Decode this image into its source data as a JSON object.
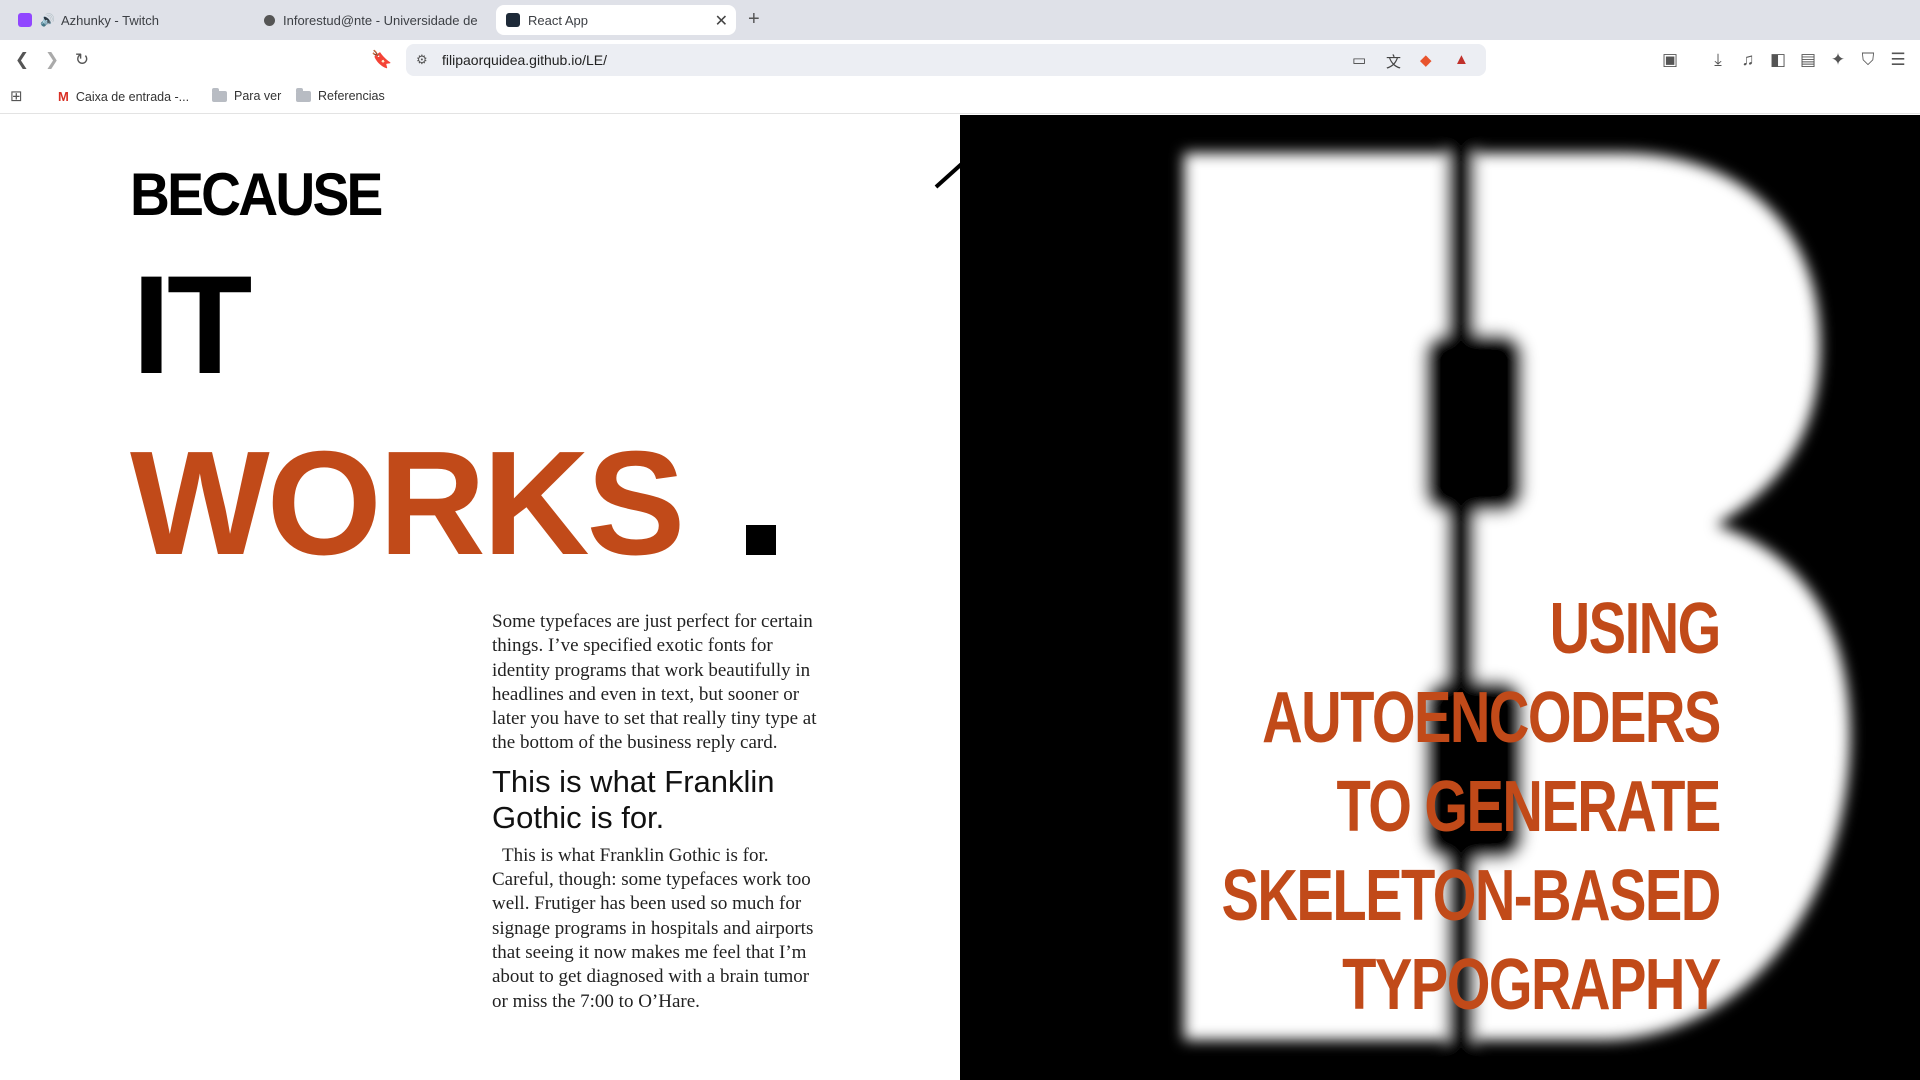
{
  "browser": {
    "tabs": [
      {
        "label": "Azhunky - Twitch",
        "favicon": "twitch-icon",
        "audio": true,
        "active": false
      },
      {
        "label": "Inforestud@nte - Universidade de",
        "favicon": "globe-icon",
        "active": false
      },
      {
        "label": "React App",
        "favicon": "react-icon",
        "active": true
      }
    ],
    "url": "filipaorquidea.github.io/LE/",
    "bookmarks": [
      {
        "label": "Caixa de entrada -...",
        "icon": "gmail-icon"
      },
      {
        "label": "Para ver",
        "icon": "folder-icon"
      },
      {
        "label": "Referencias",
        "icon": "folder-icon"
      }
    ]
  },
  "page": {
    "headline": {
      "line1": "BECAUSE",
      "line2": "IT",
      "line3": "WORKS",
      "accent_color": "#c14a19"
    },
    "paragraph1": "Some typefaces are just perfect for certain things. I’ve specified exotic fonts for identity programs that work beautifully in headlines and even in text, but sooner or later you have to set that really tiny type at the bottom of the business reply card.",
    "subheading": "This is what Franklin Gothic is for.",
    "paragraph2": "This is what Franklin Gothic is for. Careful, though: some typefaces work too well. Frutiger has been used so much for signage programs in hospitals and airports that seeing it now makes me feel that I’m about to get diagnosed with a brain tumor or miss the 7:00 to O’Hare.",
    "right_panel": {
      "letter": "B",
      "title_lines": [
        "USING",
        "AUTOENCODERS",
        "TO GENERATE",
        "SKELETON-BASED",
        "TYPOGRAPHY"
      ]
    }
  }
}
